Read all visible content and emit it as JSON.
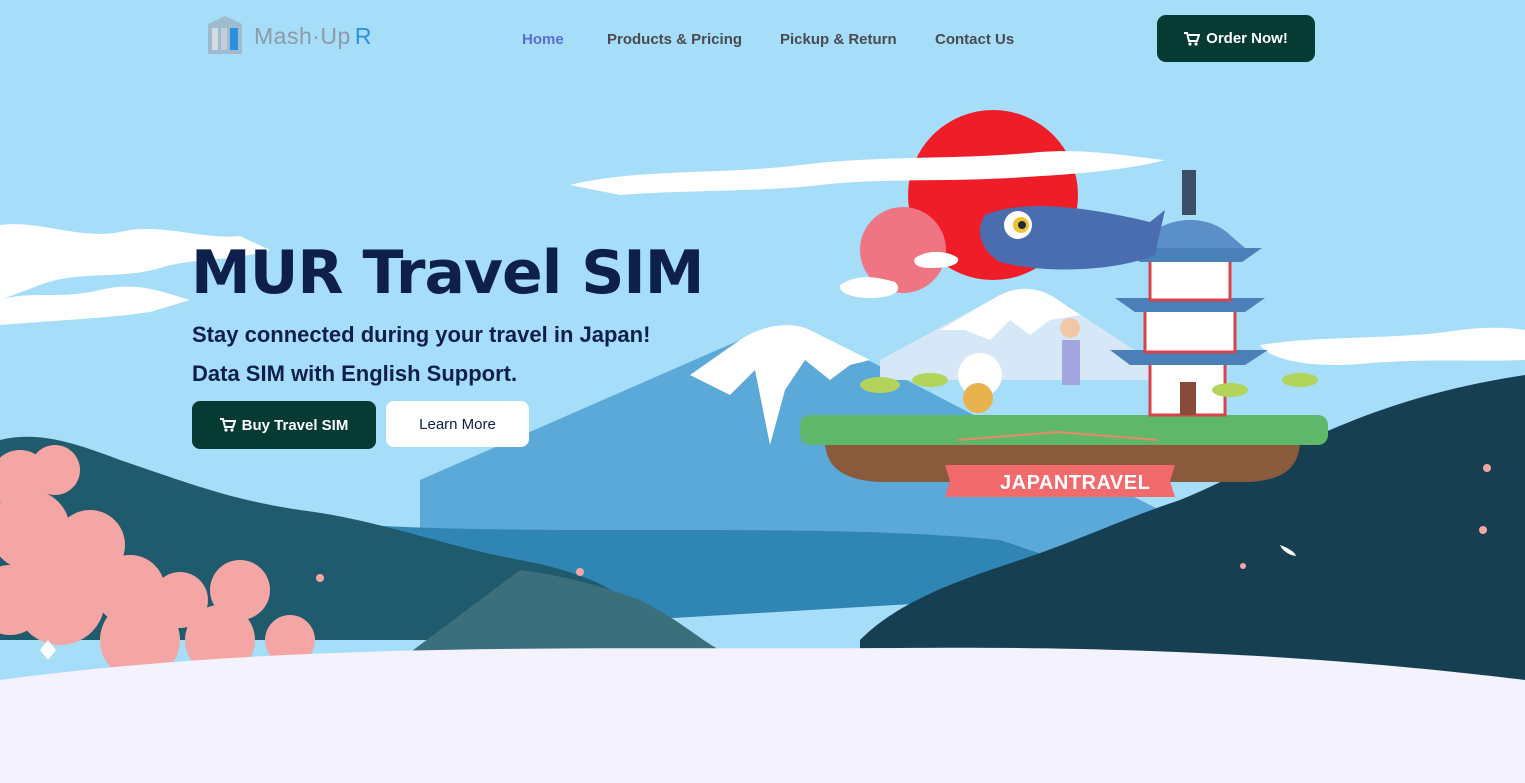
{
  "brand": {
    "logo_text": "Mash·Up",
    "logo_suffix": "R",
    "logo_icon": "building-logo-icon"
  },
  "nav": {
    "items": [
      {
        "label": "Home",
        "active": true
      },
      {
        "label": "Products & Pricing",
        "active": false
      },
      {
        "label": "Pickup & Return",
        "active": false
      },
      {
        "label": "Contact Us",
        "active": false
      }
    ],
    "order_label": "Order Now!",
    "order_icon": "cart-icon"
  },
  "hero": {
    "title": "MUR Travel SIM",
    "subtitle_line1": "Stay connected during your travel in Japan!",
    "subtitle_line2": "Data SIM with English Support.",
    "buy_label": "Buy Travel SIM",
    "learn_label": "Learn More"
  },
  "illustration": {
    "banner_text": "JAPANTRAVEL"
  },
  "colors": {
    "accent_dark": "#063b33",
    "title": "#0d1f4a",
    "nav_active": "#5a6ad6",
    "sky": "#a3dff7",
    "sun": "#ef1d27",
    "sakura": "#f4a6a4",
    "mountain_dark": "#1a4a5a"
  }
}
